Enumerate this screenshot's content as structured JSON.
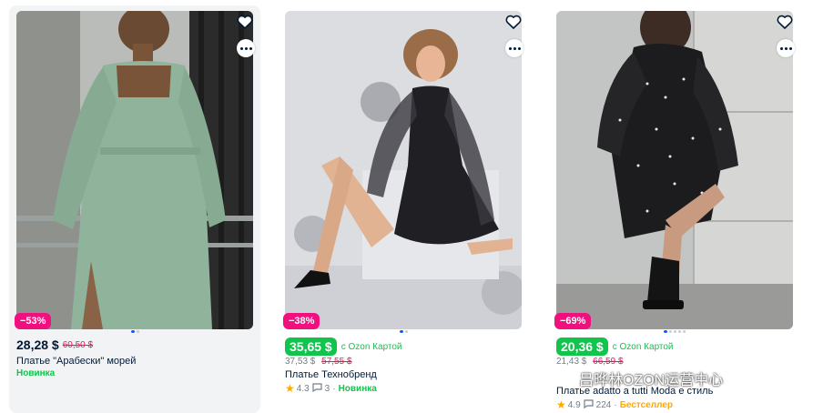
{
  "colors": {
    "discount_badge": "#f1117e",
    "green_price": "#10c44c",
    "old_price": "#f91155",
    "star": "#ffa800",
    "bestseller": "#ffa800"
  },
  "products": [
    {
      "discount": "−53%",
      "price": "28,28 $",
      "old_price": "60,50 $",
      "title": "Платье \"Арабески\" морей",
      "tag": "Новинка",
      "image_page": 1,
      "image_pages": 2
    },
    {
      "discount": "−38%",
      "card_price": "35,65 $",
      "card_label": "с Ozon Картой",
      "price": "37,53 $",
      "old_price": "57,55 $",
      "title": "Платье Технобренд",
      "rating": "4.3",
      "reviews": "3",
      "tag": "Новинка",
      "image_page": 1,
      "image_pages": 2
    },
    {
      "discount": "−69%",
      "card_price": "20,36 $",
      "card_label": "с Ozon Картой",
      "price": "21,43 $",
      "old_price": "66,59 $",
      "title": "Платье adatto a tutti Moda e стиль",
      "rating": "4.9",
      "reviews": "224",
      "tag": "Бестселлер",
      "image_page": 1,
      "image_pages": 5
    }
  ],
  "watermark": "吕晔林OZON运营中心",
  "icons": [
    "heart-outline-icon",
    "more-dots-icon",
    "star-icon",
    "comment-icon",
    "wechat-icon"
  ]
}
